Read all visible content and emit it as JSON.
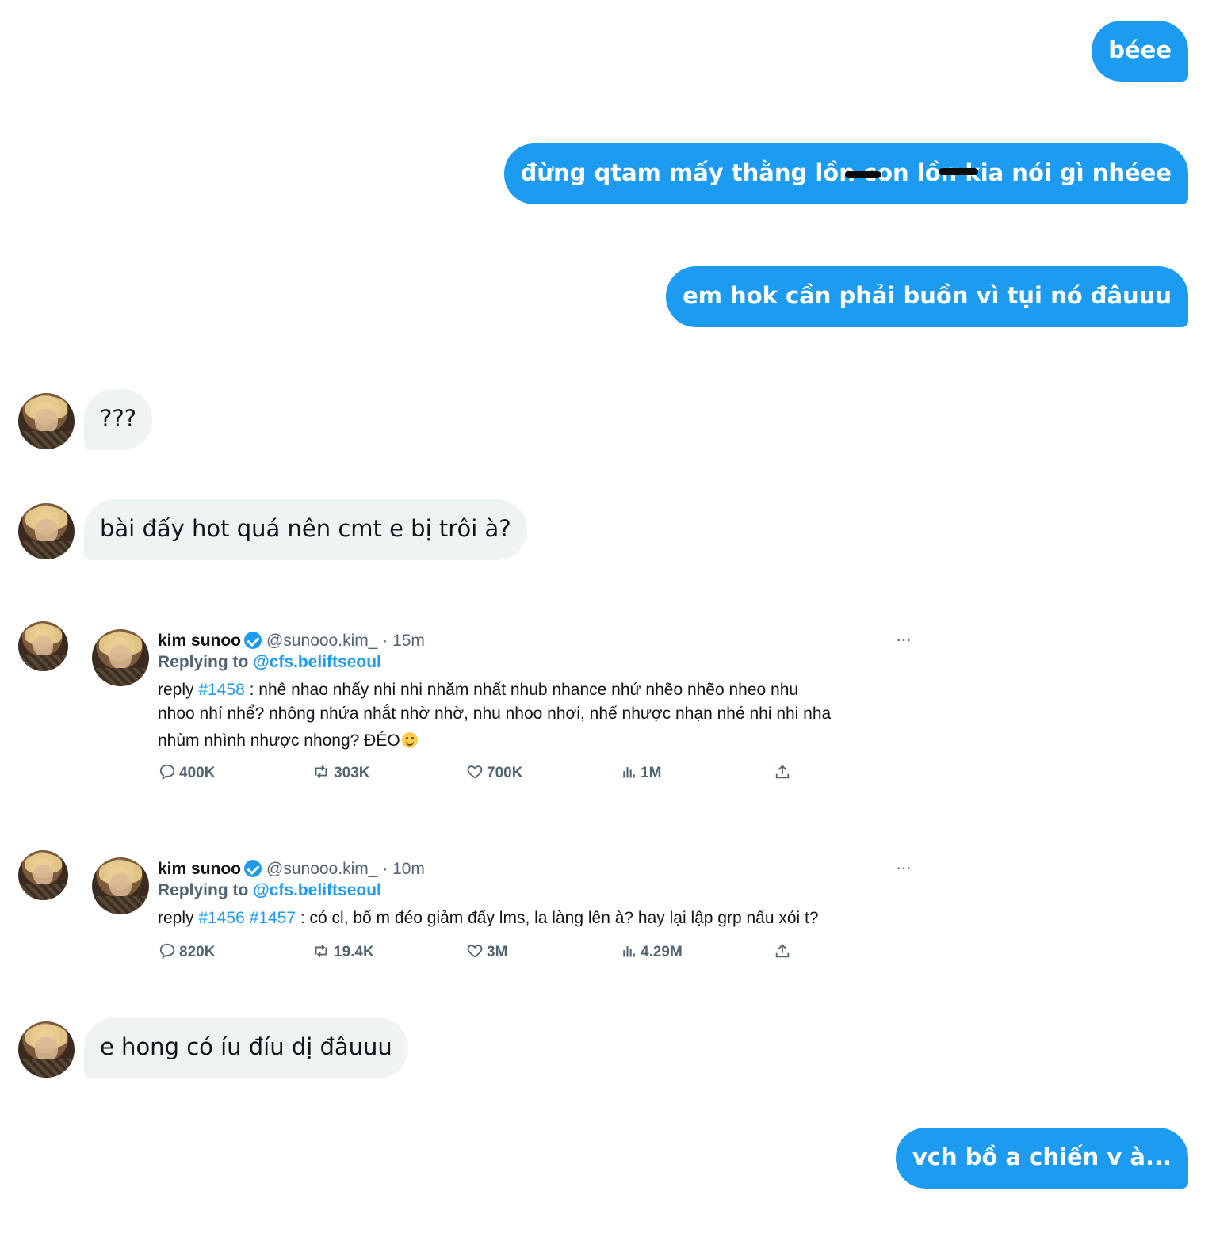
{
  "messages_outgoing": [
    {
      "text": "béee"
    },
    {
      "text": "đừng qtam mấy thằng lồn con lồn kia nói gì nhéee"
    },
    {
      "text": "em hok cần phải buồn vì tụi nó đâuuu"
    },
    {
      "text": "vch bồ a chiến v à..."
    }
  ],
  "messages_incoming": [
    {
      "text": "???"
    },
    {
      "text": "bài đấy hot quá nên cmt e bị trôi à?"
    },
    {
      "text": "e hong có íu đíu dị đâuuu"
    }
  ],
  "tweets": [
    {
      "name": "kim sunoo",
      "handle": "@sunooo.kim_",
      "time": "· 15m",
      "replying_label": "Replying to",
      "replying_to": "@cfs.beliftseoul",
      "body_prefix": "reply",
      "tags": "#1458",
      "body_line1": " : nhê nhao nhấy nhi nhi nhăm nhất nhub nhance nhứ nhẽo nhẽo nheo nhu",
      "body_line2": "nhoo nhí nhể? nhông nhứa nhắt nhờ nhờ, nhu nhoo nhơi, nhế nhược nhạn nhé nhi nhi nha",
      "body_line3": "nhùm nhình nhược nhong? ĐÉO",
      "more": "···",
      "stats": {
        "replies": "400K",
        "retweets": "303K",
        "likes": "700K",
        "views": "1M"
      }
    },
    {
      "name": "kim sunoo",
      "handle": "@sunooo.kim_",
      "time": "· 10m",
      "replying_label": "Replying to",
      "replying_to": "@cfs.beliftseoul",
      "body_prefix": "reply",
      "tags": "#1456 #1457",
      "body_line1": " : có cl, bố m đéo giảm đấy lms, la làng lên à? hay lại lập grp nấu xói t?",
      "more": "···",
      "stats": {
        "replies": "820K",
        "retweets": "19.4K",
        "likes": "3M",
        "views": "4.29M"
      }
    }
  ],
  "colors": {
    "accent": "#1d9bf0",
    "incoming_bg": "#eff3f4",
    "muted": "#536471"
  },
  "icons": [
    "reply-icon",
    "retweet-icon",
    "like-icon",
    "views-icon",
    "share-icon",
    "verified-badge-icon",
    "smile-emoji-icon"
  ]
}
